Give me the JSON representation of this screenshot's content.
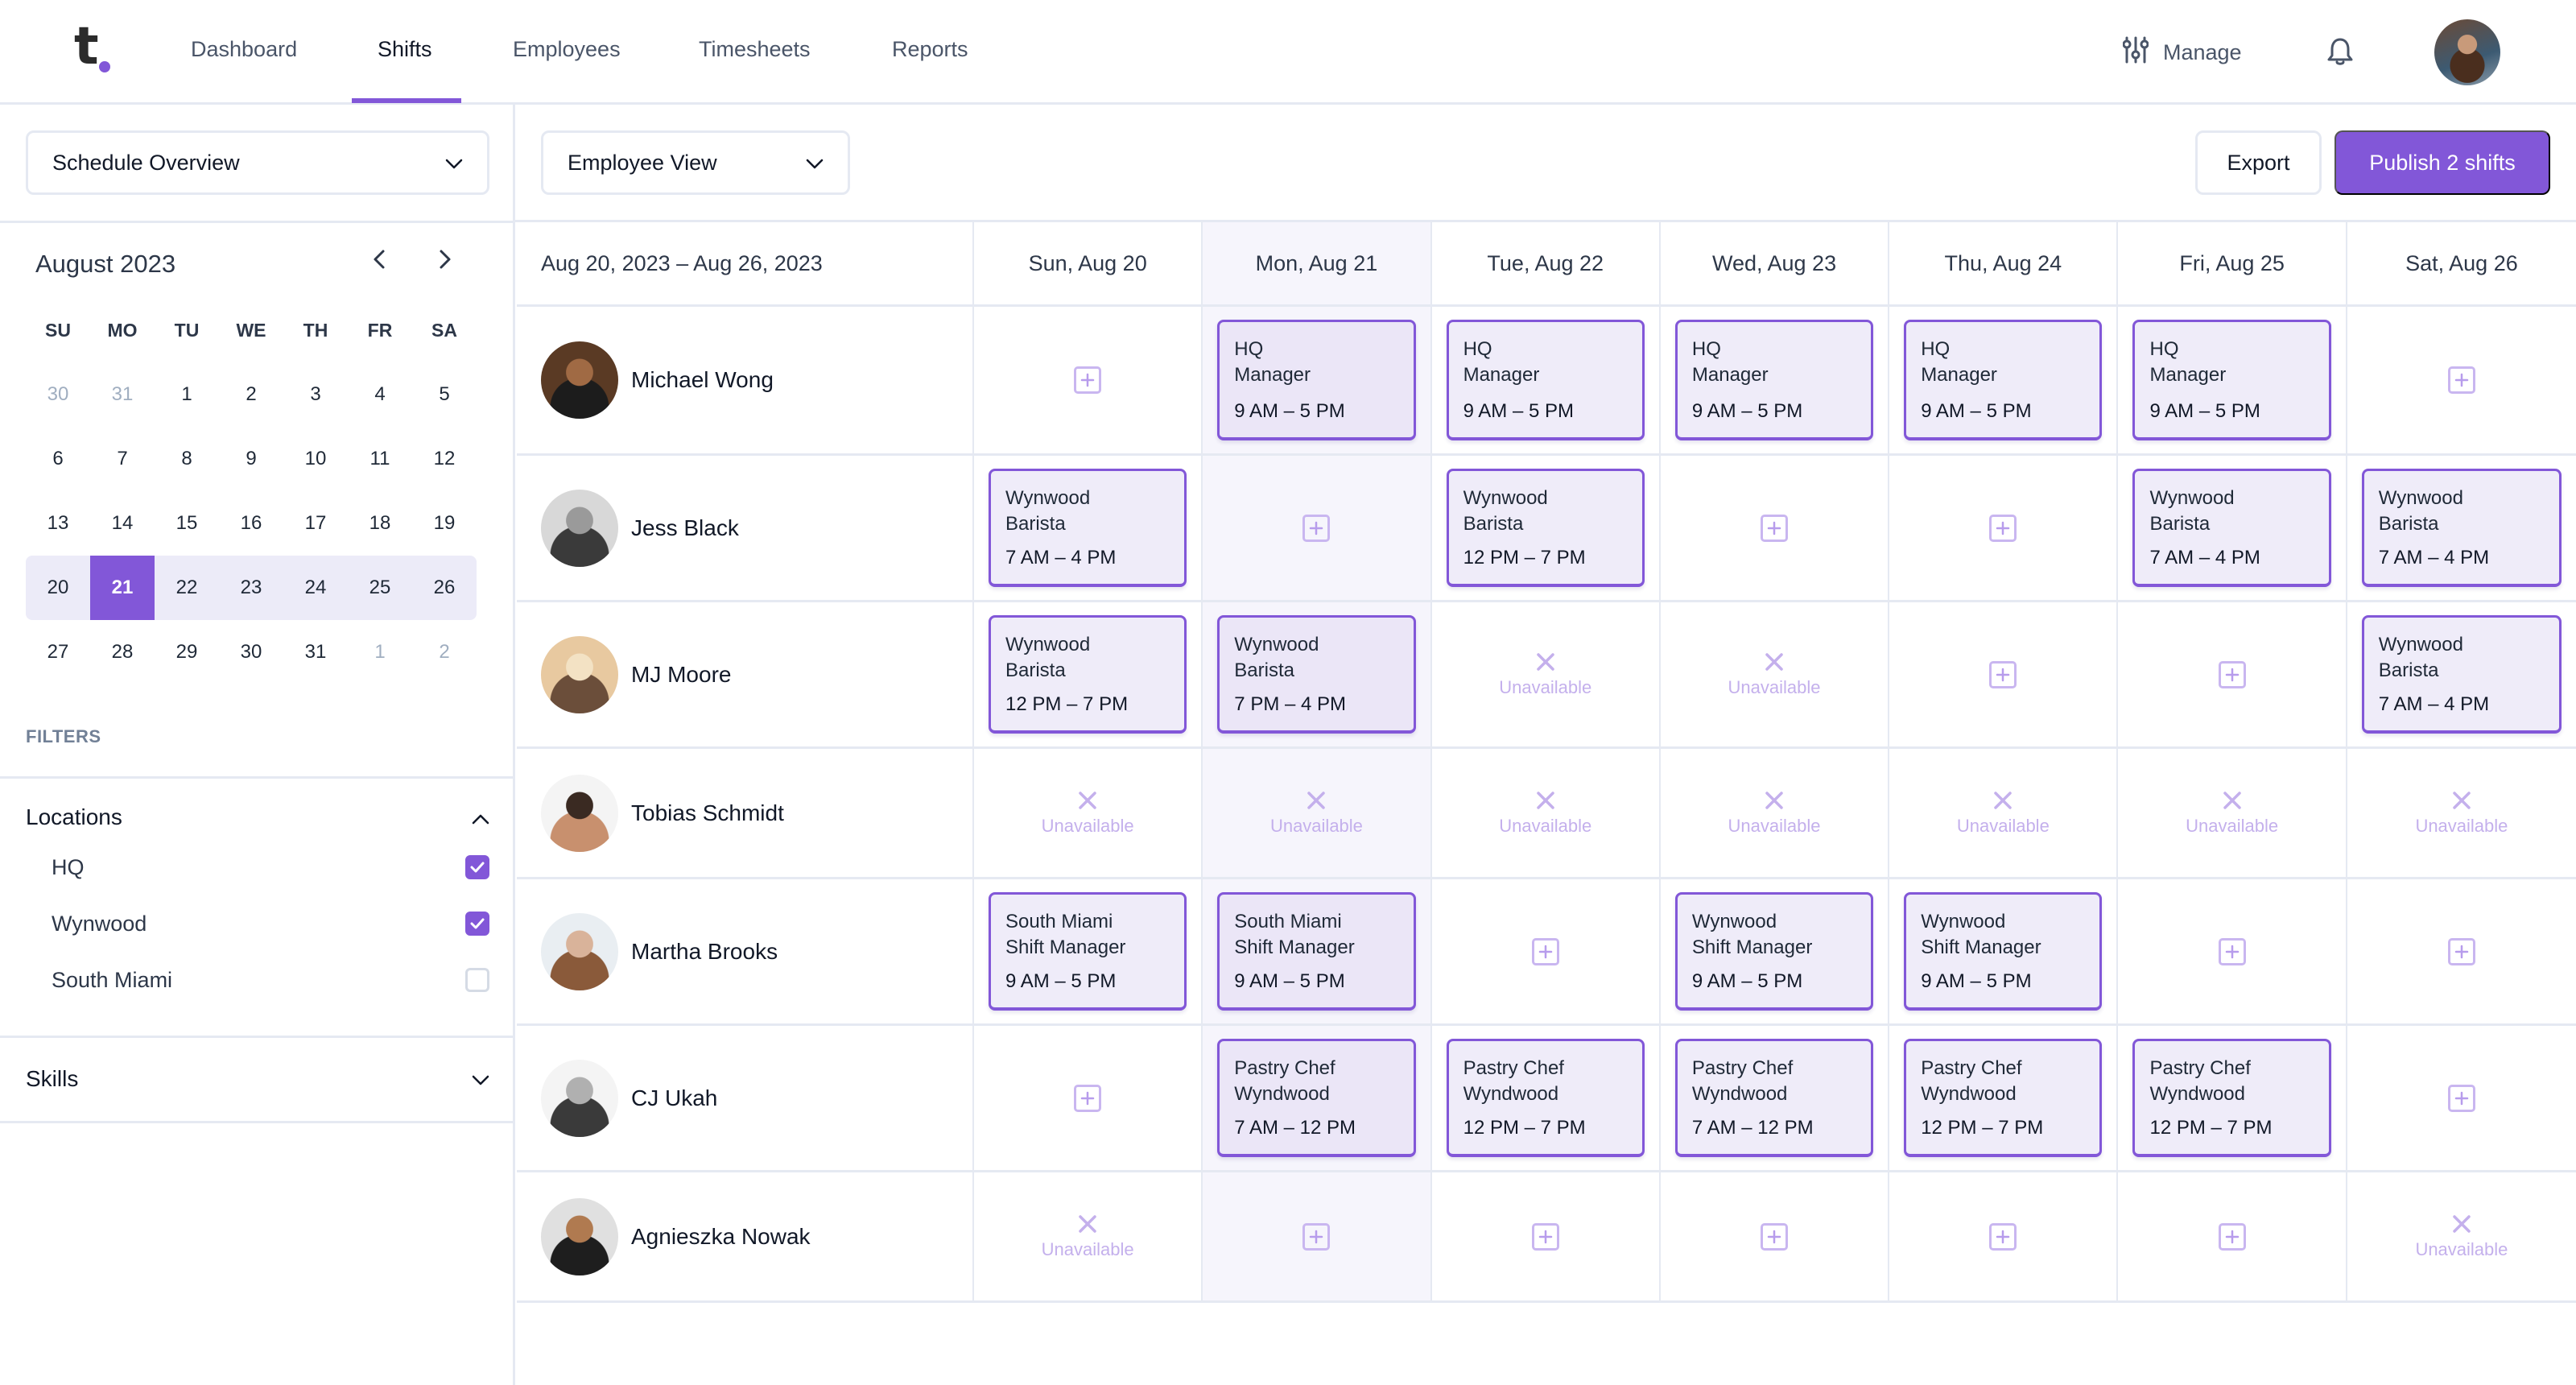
{
  "nav": {
    "logo": "t",
    "items": [
      {
        "label": "Dashboard",
        "active": false
      },
      {
        "label": "Shifts",
        "active": true
      },
      {
        "label": "Employees",
        "active": false
      },
      {
        "label": "Timesheets",
        "active": false
      },
      {
        "label": "Reports",
        "active": false
      }
    ],
    "manage_label": "Manage",
    "icons": {
      "manage": "sliders-icon",
      "notifications": "bell-icon",
      "avatar": "user-avatar"
    }
  },
  "sidebar": {
    "schedule_select": "Schedule Overview",
    "calendar": {
      "title": "August 2023",
      "weekdays": [
        "SU",
        "MO",
        "TU",
        "WE",
        "TH",
        "FR",
        "SA"
      ],
      "weeks": [
        [
          {
            "d": "30",
            "muted": true
          },
          {
            "d": "31",
            "muted": true
          },
          {
            "d": "1"
          },
          {
            "d": "2"
          },
          {
            "d": "3"
          },
          {
            "d": "4"
          },
          {
            "d": "5"
          }
        ],
        [
          {
            "d": "6"
          },
          {
            "d": "7"
          },
          {
            "d": "8"
          },
          {
            "d": "9"
          },
          {
            "d": "10"
          },
          {
            "d": "11"
          },
          {
            "d": "12"
          }
        ],
        [
          {
            "d": "13"
          },
          {
            "d": "14"
          },
          {
            "d": "15"
          },
          {
            "d": "16"
          },
          {
            "d": "17"
          },
          {
            "d": "18"
          },
          {
            "d": "19"
          }
        ],
        [
          {
            "d": "20"
          },
          {
            "d": "21",
            "selected": true
          },
          {
            "d": "22"
          },
          {
            "d": "23"
          },
          {
            "d": "24"
          },
          {
            "d": "25"
          },
          {
            "d": "26"
          }
        ],
        [
          {
            "d": "27"
          },
          {
            "d": "28"
          },
          {
            "d": "29"
          },
          {
            "d": "30"
          },
          {
            "d": "31"
          },
          {
            "d": "1",
            "muted": true
          },
          {
            "d": "2",
            "muted": true
          }
        ]
      ],
      "selected_week_index": 3
    },
    "filters_label": "FILTERS",
    "locations": {
      "label": "Locations",
      "expanded": true,
      "items": [
        {
          "label": "HQ",
          "checked": true
        },
        {
          "label": "Wynwood",
          "checked": true
        },
        {
          "label": "South Miami",
          "checked": false
        }
      ]
    },
    "skills": {
      "label": "Skills",
      "expanded": false
    }
  },
  "toolbar": {
    "view_select": "Employee View",
    "export_label": "Export",
    "publish_label": "Publish 2 shifts"
  },
  "schedule": {
    "range_label": "Aug 20, 2023 – Aug 26, 2023",
    "days": [
      "Sun, Aug 20",
      "Mon, Aug 21",
      "Tue, Aug 22",
      "Wed, Aug 23",
      "Thu, Aug 24",
      "Fri, Aug 25",
      "Sat, Aug 26"
    ],
    "highlight_day_index": 1,
    "unavailable_label": "Unavailable",
    "employees": [
      {
        "name": "Michael Wong",
        "avatar_colors": [
          "#5a3a24",
          "#1c1c1c",
          "#a06a44"
        ],
        "cells": [
          {
            "type": "add"
          },
          {
            "type": "shift",
            "l1": "HQ",
            "l2": "Manager",
            "time": "9 AM – 5 PM"
          },
          {
            "type": "shift",
            "l1": "HQ",
            "l2": "Manager",
            "time": "9 AM – 5 PM"
          },
          {
            "type": "shift",
            "l1": "HQ",
            "l2": "Manager",
            "time": "9 AM – 5 PM"
          },
          {
            "type": "shift",
            "l1": "HQ",
            "l2": "Manager",
            "time": "9 AM – 5 PM"
          },
          {
            "type": "shift",
            "l1": "HQ",
            "l2": "Manager",
            "time": "9 AM – 5 PM"
          },
          {
            "type": "add"
          }
        ]
      },
      {
        "name": "Jess Black",
        "avatar_colors": [
          "#d8d8d8",
          "#3a3a3a",
          "#9a9a9a"
        ],
        "cells": [
          {
            "type": "shift",
            "l1": "Wynwood",
            "l2": "Barista",
            "time": "7 AM – 4 PM"
          },
          {
            "type": "add"
          },
          {
            "type": "shift",
            "l1": "Wynwood",
            "l2": "Barista",
            "time": "12 PM – 7 PM"
          },
          {
            "type": "add"
          },
          {
            "type": "add"
          },
          {
            "type": "shift",
            "l1": "Wynwood",
            "l2": "Barista",
            "time": "7 AM – 4 PM"
          },
          {
            "type": "shift",
            "l1": "Wynwood",
            "l2": "Barista",
            "time": "7 AM – 4 PM"
          }
        ]
      },
      {
        "name": "MJ Moore",
        "avatar_colors": [
          "#e8c9a0",
          "#6b4e3a",
          "#f3e2c4"
        ],
        "cells": [
          {
            "type": "shift",
            "l1": "Wynwood",
            "l2": "Barista",
            "time": "12 PM – 7 PM"
          },
          {
            "type": "shift",
            "l1": "Wynwood",
            "l2": "Barista",
            "time": "7 PM – 4 PM"
          },
          {
            "type": "unavailable"
          },
          {
            "type": "unavailable"
          },
          {
            "type": "add"
          },
          {
            "type": "add"
          },
          {
            "type": "shift",
            "l1": "Wynwood",
            "l2": "Barista",
            "time": "7 AM – 4 PM"
          }
        ]
      },
      {
        "name": "Tobias Schmidt",
        "avatar_colors": [
          "#f4f4f4",
          "#c8906e",
          "#3a2a22"
        ],
        "cells": [
          {
            "type": "unavailable"
          },
          {
            "type": "unavailable"
          },
          {
            "type": "unavailable"
          },
          {
            "type": "unavailable"
          },
          {
            "type": "unavailable"
          },
          {
            "type": "unavailable"
          },
          {
            "type": "unavailable"
          }
        ]
      },
      {
        "name": "Martha Brooks",
        "avatar_colors": [
          "#e9eef2",
          "#8a5a3a",
          "#d9b39a"
        ],
        "cells": [
          {
            "type": "shift",
            "l1": "South Miami",
            "l2": "Shift Manager",
            "time": "9 AM – 5 PM"
          },
          {
            "type": "shift",
            "l1": "South Miami",
            "l2": "Shift Manager",
            "time": "9 AM – 5 PM"
          },
          {
            "type": "add"
          },
          {
            "type": "shift",
            "l1": "Wynwood",
            "l2": "Shift Manager",
            "time": "9 AM – 5 PM"
          },
          {
            "type": "shift",
            "l1": "Wynwood",
            "l2": "Shift Manager",
            "time": "9 AM – 5 PM"
          },
          {
            "type": "add"
          },
          {
            "type": "add"
          }
        ]
      },
      {
        "name": "CJ Ukah",
        "avatar_colors": [
          "#f4f4f4",
          "#3a3a3a",
          "#b0b0b0"
        ],
        "cells": [
          {
            "type": "add"
          },
          {
            "type": "shift",
            "l1": "Pastry Chef",
            "l2": "Wyndwood",
            "time": "7 AM – 12 PM"
          },
          {
            "type": "shift",
            "l1": "Pastry Chef",
            "l2": "Wyndwood",
            "time": "12 PM – 7 PM"
          },
          {
            "type": "shift",
            "l1": "Pastry Chef",
            "l2": "Wyndwood",
            "time": "7 AM – 12 PM"
          },
          {
            "type": "shift",
            "l1": "Pastry Chef",
            "l2": "Wyndwood",
            "time": "12 PM – 7 PM"
          },
          {
            "type": "shift",
            "l1": "Pastry Chef",
            "l2": "Wyndwood",
            "time": "12 PM – 7 PM"
          },
          {
            "type": "add"
          }
        ]
      },
      {
        "name": "Agnieszka Nowak",
        "avatar_colors": [
          "#e0e0e0",
          "#1e1e1e",
          "#b07a50"
        ],
        "cells": [
          {
            "type": "unavailable"
          },
          {
            "type": "add"
          },
          {
            "type": "add"
          },
          {
            "type": "add"
          },
          {
            "type": "add"
          },
          {
            "type": "add"
          },
          {
            "type": "unavailable"
          }
        ]
      }
    ]
  },
  "colors": {
    "accent": "#8257d8",
    "card_bg": "#efecf9",
    "today_col_bg": "#f6f5fc",
    "border": "#e5e9f2",
    "unavailable": "#c4b0ec"
  }
}
